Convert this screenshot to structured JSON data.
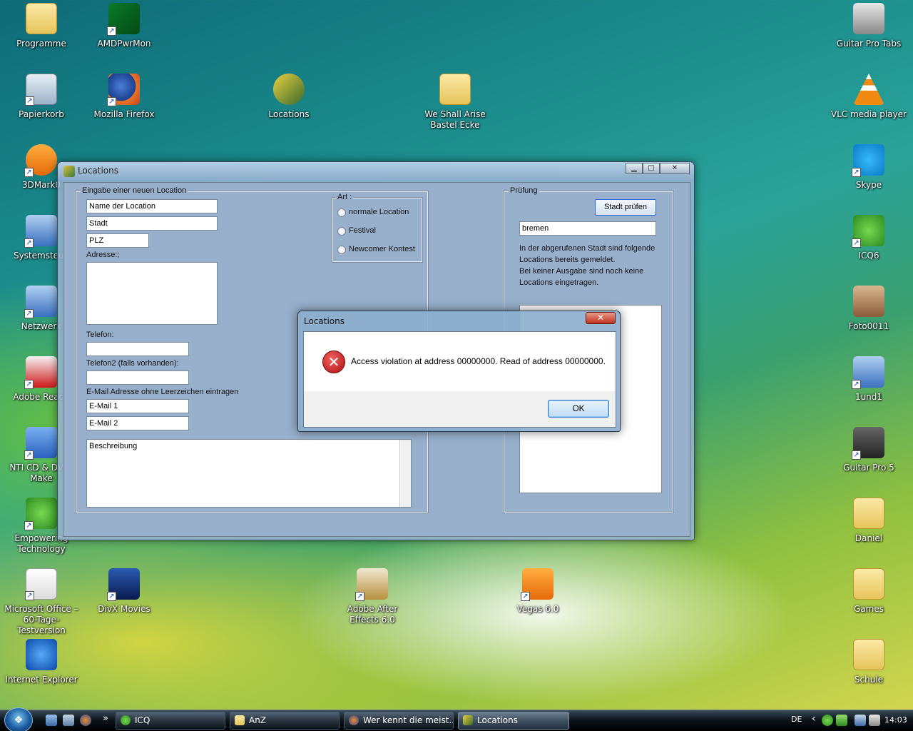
{
  "desktop": {
    "icons": [
      {
        "label": "Programme"
      },
      {
        "label": "AMDPwrMon"
      },
      {
        "label": "Papierkorb"
      },
      {
        "label": "Mozilla Firefox"
      },
      {
        "label": "Locations"
      },
      {
        "label": "We Shall Arise Bastel Ecke"
      },
      {
        "label": "3DMark0"
      },
      {
        "label": "Systemsteue"
      },
      {
        "label": "Netzwerk"
      },
      {
        "label": "Adobe Reade"
      },
      {
        "label": "NTI CD & DVD-Make"
      },
      {
        "label": "Empowering Technology"
      },
      {
        "label": "Microsoft Office – 60-Tage-Testversion"
      },
      {
        "label": "DivX Movies"
      },
      {
        "label": "Adobe After Effects 6.0"
      },
      {
        "label": "Vegas 6.0"
      },
      {
        "label": "Internet Explorer"
      },
      {
        "label": "Guitar Pro Tabs"
      },
      {
        "label": "VLC media player"
      },
      {
        "label": "Skype"
      },
      {
        "label": "ICQ6"
      },
      {
        "label": "Foto0011"
      },
      {
        "label": "1und1"
      },
      {
        "label": "Guitar Pro 5"
      },
      {
        "label": "Daniel"
      },
      {
        "label": "Games"
      },
      {
        "label": "Schule"
      }
    ]
  },
  "app_window": {
    "title": "Locations",
    "min_glyph": "▁",
    "max_glyph": "□",
    "close_glyph": "✕",
    "group_new": {
      "legend": "Eingabe einer neuen Location",
      "name_value": "Name der Location",
      "city_value": "Stadt",
      "zip_value": "PLZ",
      "address_label": "Adresse:;",
      "phone_label": "Telefon:",
      "phone2_label": "Telefon2 (falls vorhanden):",
      "email_label": "E-Mail Adresse ohne Leerzeichen eintragen",
      "email1_value": "E-Mail 1",
      "email2_value": "E-Mail 2",
      "description_value": "Beschreibung"
    },
    "group_type": {
      "legend": "Art :",
      "options": [
        "normale Location",
        "Festival",
        "Newcomer Kontest"
      ]
    },
    "group_check": {
      "legend": "Prüfung",
      "check_button": "Stadt prüfen",
      "city_value": "bremen",
      "info_lines": [
        "In der abgerufenen Stadt sind folgende",
        "Locations bereits gemeldet.",
        "Bei keiner Ausgabe sind noch keine",
        "Locations eingetragen."
      ]
    }
  },
  "dialog": {
    "title": "Locations",
    "close_glyph": "✕",
    "icon_glyph": "✕",
    "message": "Access violation at address 00000000. Read of address 00000000.",
    "ok_label": "OK"
  },
  "taskbar": {
    "start_glyph": "❖",
    "overflow_glyph": "»",
    "tasks": [
      {
        "label": "ICQ"
      },
      {
        "label": "AnZ"
      },
      {
        "label": "Wer kennt die meist..."
      },
      {
        "label": "Locations"
      }
    ],
    "language": "DE",
    "tray_arrow": "‹",
    "clock": "14:03"
  },
  "colors": {
    "window_face": "#98b0cc",
    "dialog_close": "#c0321a",
    "ok_border": "#3a7ad0"
  }
}
